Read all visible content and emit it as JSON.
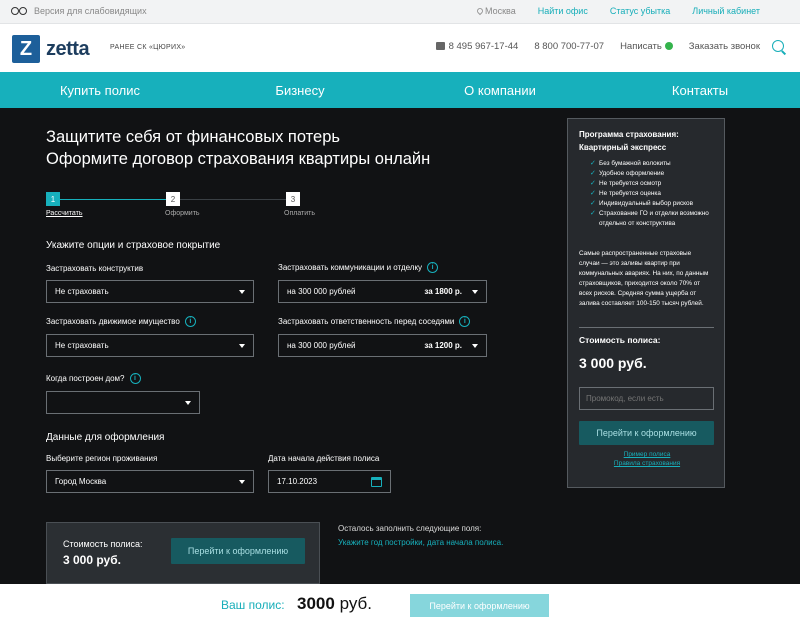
{
  "topbar": {
    "accessible_label": "Версия для слабовидящих",
    "city": "Москва",
    "links": [
      "Найти офис",
      "Статус убытка",
      "Личный кабинет"
    ]
  },
  "header": {
    "logo_letter": "Z",
    "logo_text": "zetta",
    "formerly": "РАНЕЕ СК «ЦЮРИХ»",
    "phone1": "8 495 967-17-44",
    "phone2": "8 800 700-77-07",
    "write": "Написать",
    "callback": "Заказать звонок"
  },
  "nav": [
    "Купить полис",
    "Бизнесу",
    "О компании",
    "Контакты"
  ],
  "main": {
    "title1": "Защитите себя от финансовых потерь",
    "title2": "Оформите договор страхования квартиры онлайн",
    "steps": [
      {
        "num": "1",
        "label": "Рассчитать"
      },
      {
        "num": "2",
        "label": "Оформить"
      },
      {
        "num": "3",
        "label": "Оплатить"
      }
    ],
    "options_heading": "Укажите опции и страховое покрытие",
    "f_construct_label": "Застраховать конструктив",
    "f_construct_value": "Не страховать",
    "f_comm_label": "Застраховать коммуникации и отделку",
    "f_comm_value": "на 300 000 рублей",
    "f_comm_price": "за 1800 р.",
    "f_movable_label": "Застраховать движимое имущество",
    "f_movable_value": "Не страховать",
    "f_liab_label": "Застраховать ответственность перед соседями",
    "f_liab_value": "на 300 000 рублей",
    "f_liab_price": "за 1200 р.",
    "f_built_label": "Когда построен дом?",
    "f_built_value": "",
    "data_heading": "Данные для оформления",
    "f_region_label": "Выберите регион проживания",
    "f_region_value": "Город Москва",
    "f_date_label": "Дата начала действия полиса",
    "f_date_value": "17.10.2023",
    "card_label": "Стоимость полиса:",
    "card_value": "3 000 руб.",
    "card_button": "Перейти к оформлению",
    "remain_text": "Осталось заполнить следующие поля:",
    "remain_link": "Укажите год постройки, дата начала полиса."
  },
  "panel": {
    "heading": "Программа страхования: Квартирный экспресс",
    "features": [
      "Без бумажной волокиты",
      "Удобное оформление",
      "Не требуется осмотр",
      "Не требуется оценка",
      "Индивидуальный выбор рисков",
      "Страхование ГО и отделки возможно отдельно от конструктива"
    ],
    "description": "Самые распространенные страховые случаи — это заливы квартир при коммунальных авариях. На них, по данным страховщиков, приходится около 70% от всех рисков. Средняя сумма ущерба от залива составляет 100-150 тысяч рублей.",
    "cost_label": "Стоимость полиса:",
    "cost_value": "3 000 руб.",
    "promo_placeholder": "Промокод, если есть",
    "button": "Перейти к оформлению",
    "link1": "Пример полиса",
    "link2": "Правила страхования"
  },
  "footer": {
    "label": "Ваш полис:",
    "amount": "3000",
    "currency": "руб.",
    "button": "Перейти к оформлению"
  },
  "colors": {
    "accent": "#17b0bc",
    "dark_bg": "#111214",
    "panel_bg": "#26292d",
    "button_dark": "#175a60",
    "button_light": "#86d6dc"
  }
}
